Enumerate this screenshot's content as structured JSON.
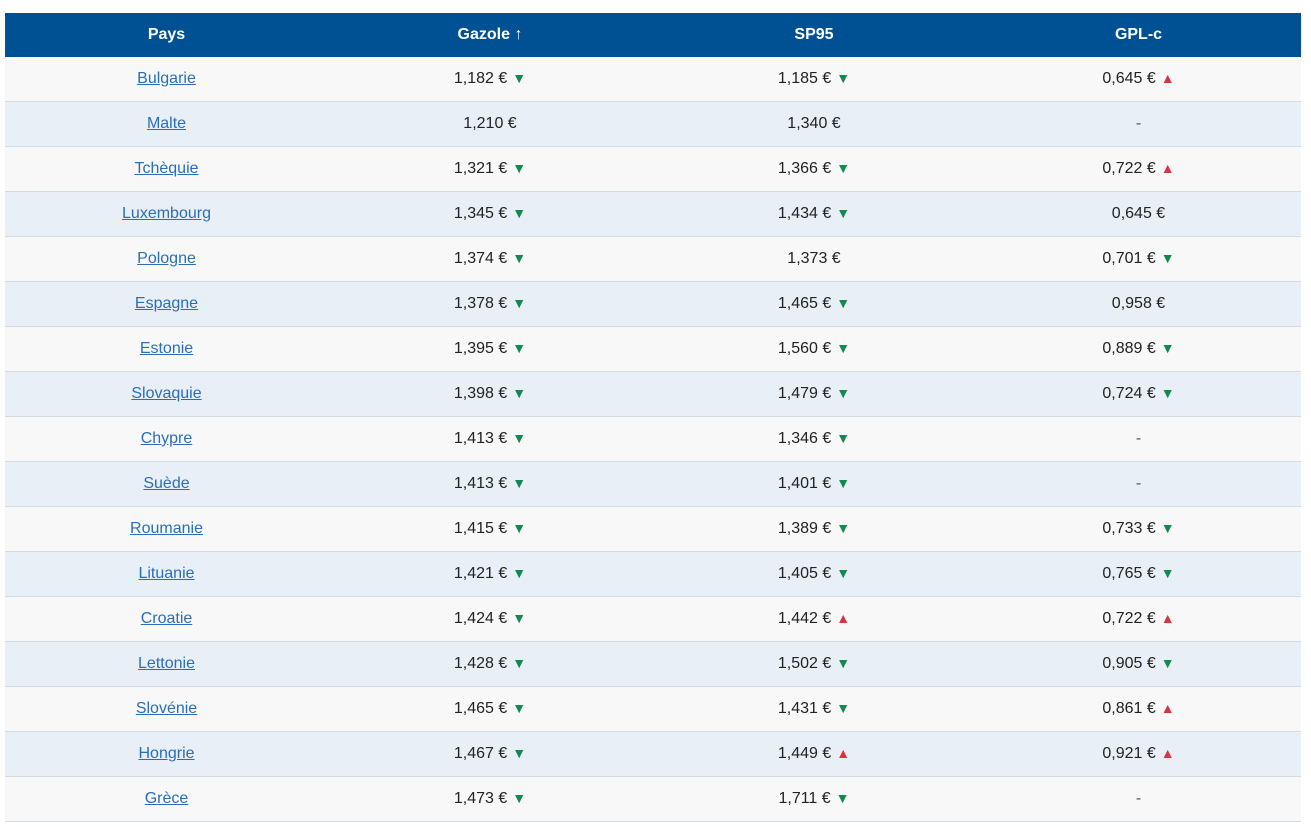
{
  "colors": {
    "header_bg": "#005193",
    "row_odd": "#f8f8f8",
    "row_even": "#e8eff6",
    "link": "#2a6fb6",
    "trend_down": "#138a4d",
    "trend_up": "#d9333f"
  },
  "table": {
    "headers": [
      "Pays",
      "Gazole ↑",
      "SP95",
      "GPL-c"
    ],
    "rows": [
      {
        "country": "Bulgarie",
        "gazole": {
          "price": "1,182 €",
          "trend": "down"
        },
        "sp95": {
          "price": "1,185 €",
          "trend": "down"
        },
        "gplc": {
          "price": "0,645 €",
          "trend": "up"
        }
      },
      {
        "country": "Malte",
        "gazole": {
          "price": "1,210 €",
          "trend": ""
        },
        "sp95": {
          "price": "1,340 €",
          "trend": ""
        },
        "gplc": {
          "price": "-",
          "trend": ""
        }
      },
      {
        "country": "Tchèquie",
        "gazole": {
          "price": "1,321 €",
          "trend": "down"
        },
        "sp95": {
          "price": "1,366 €",
          "trend": "down"
        },
        "gplc": {
          "price": "0,722 €",
          "trend": "up"
        }
      },
      {
        "country": "Luxembourg",
        "gazole": {
          "price": "1,345 €",
          "trend": "down"
        },
        "sp95": {
          "price": "1,434 €",
          "trend": "down"
        },
        "gplc": {
          "price": "0,645 €",
          "trend": ""
        }
      },
      {
        "country": "Pologne",
        "gazole": {
          "price": "1,374 €",
          "trend": "down"
        },
        "sp95": {
          "price": "1,373 €",
          "trend": ""
        },
        "gplc": {
          "price": "0,701 €",
          "trend": "down"
        }
      },
      {
        "country": "Espagne",
        "gazole": {
          "price": "1,378 €",
          "trend": "down"
        },
        "sp95": {
          "price": "1,465 €",
          "trend": "down"
        },
        "gplc": {
          "price": "0,958 €",
          "trend": ""
        }
      },
      {
        "country": "Estonie",
        "gazole": {
          "price": "1,395 €",
          "trend": "down"
        },
        "sp95": {
          "price": "1,560 €",
          "trend": "down"
        },
        "gplc": {
          "price": "0,889 €",
          "trend": "down"
        }
      },
      {
        "country": "Slovaquie",
        "gazole": {
          "price": "1,398 €",
          "trend": "down"
        },
        "sp95": {
          "price": "1,479 €",
          "trend": "down"
        },
        "gplc": {
          "price": "0,724 €",
          "trend": "down"
        }
      },
      {
        "country": "Chypre",
        "gazole": {
          "price": "1,413 €",
          "trend": "down"
        },
        "sp95": {
          "price": "1,346 €",
          "trend": "down"
        },
        "gplc": {
          "price": "-",
          "trend": ""
        }
      },
      {
        "country": "Suède",
        "gazole": {
          "price": "1,413 €",
          "trend": "down"
        },
        "sp95": {
          "price": "1,401 €",
          "trend": "down"
        },
        "gplc": {
          "price": "-",
          "trend": ""
        }
      },
      {
        "country": "Roumanie",
        "gazole": {
          "price": "1,415 €",
          "trend": "down"
        },
        "sp95": {
          "price": "1,389 €",
          "trend": "down"
        },
        "gplc": {
          "price": "0,733 €",
          "trend": "down"
        }
      },
      {
        "country": "Lituanie",
        "gazole": {
          "price": "1,421 €",
          "trend": "down"
        },
        "sp95": {
          "price": "1,405 €",
          "trend": "down"
        },
        "gplc": {
          "price": "0,765 €",
          "trend": "down"
        }
      },
      {
        "country": "Croatie",
        "gazole": {
          "price": "1,424 €",
          "trend": "down"
        },
        "sp95": {
          "price": "1,442 €",
          "trend": "up"
        },
        "gplc": {
          "price": "0,722 €",
          "trend": "up"
        }
      },
      {
        "country": "Lettonie",
        "gazole": {
          "price": "1,428 €",
          "trend": "down"
        },
        "sp95": {
          "price": "1,502 €",
          "trend": "down"
        },
        "gplc": {
          "price": "0,905 €",
          "trend": "down"
        }
      },
      {
        "country": "Slovénie",
        "gazole": {
          "price": "1,465 €",
          "trend": "down"
        },
        "sp95": {
          "price": "1,431 €",
          "trend": "down"
        },
        "gplc": {
          "price": "0,861 €",
          "trend": "up"
        }
      },
      {
        "country": "Hongrie",
        "gazole": {
          "price": "1,467 €",
          "trend": "down"
        },
        "sp95": {
          "price": "1,449 €",
          "trend": "up"
        },
        "gplc": {
          "price": "0,921 €",
          "trend": "up"
        }
      },
      {
        "country": "Grèce",
        "gazole": {
          "price": "1,473 €",
          "trend": "down"
        },
        "sp95": {
          "price": "1,711 €",
          "trend": "down"
        },
        "gplc": {
          "price": "-",
          "trend": ""
        }
      }
    ]
  }
}
